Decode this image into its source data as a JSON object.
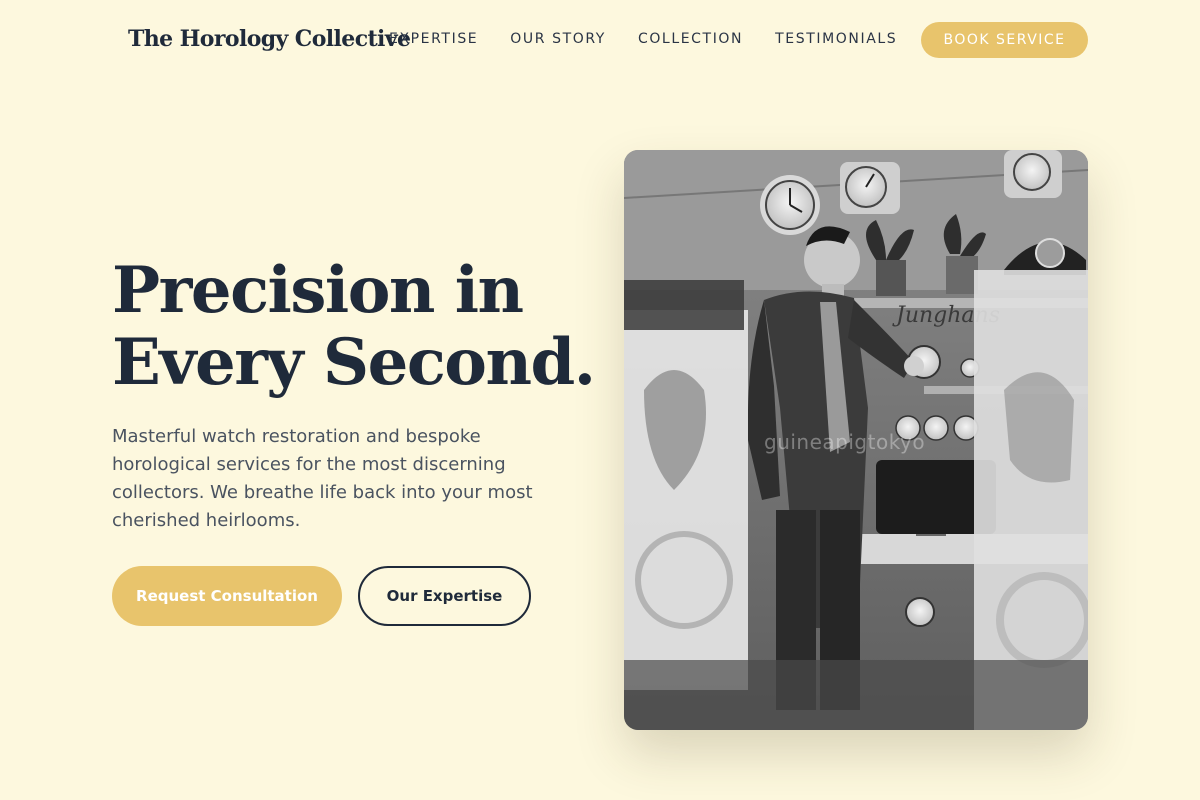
{
  "brand": {
    "name": "The Horology Collective"
  },
  "nav": {
    "links": [
      "EXPERTISE",
      "OUR STORY",
      "COLLECTION",
      "TESTIMONIALS"
    ],
    "cta": "BOOK SERVICE"
  },
  "hero": {
    "title_line1": "Precision in",
    "title_line2": "Every Second.",
    "description": "Masterful watch restoration and bespoke horological services for the most discerning collectors. We breathe life back into your most cherished heirlooms.",
    "primary_button": "Request Consultation",
    "secondary_button": "Our Expertise"
  },
  "image": {
    "watermark": "guineapigtokyo"
  },
  "colors": {
    "background": "#fdf8de",
    "accent": "#e8c46c",
    "text": "#1f2a3a"
  }
}
